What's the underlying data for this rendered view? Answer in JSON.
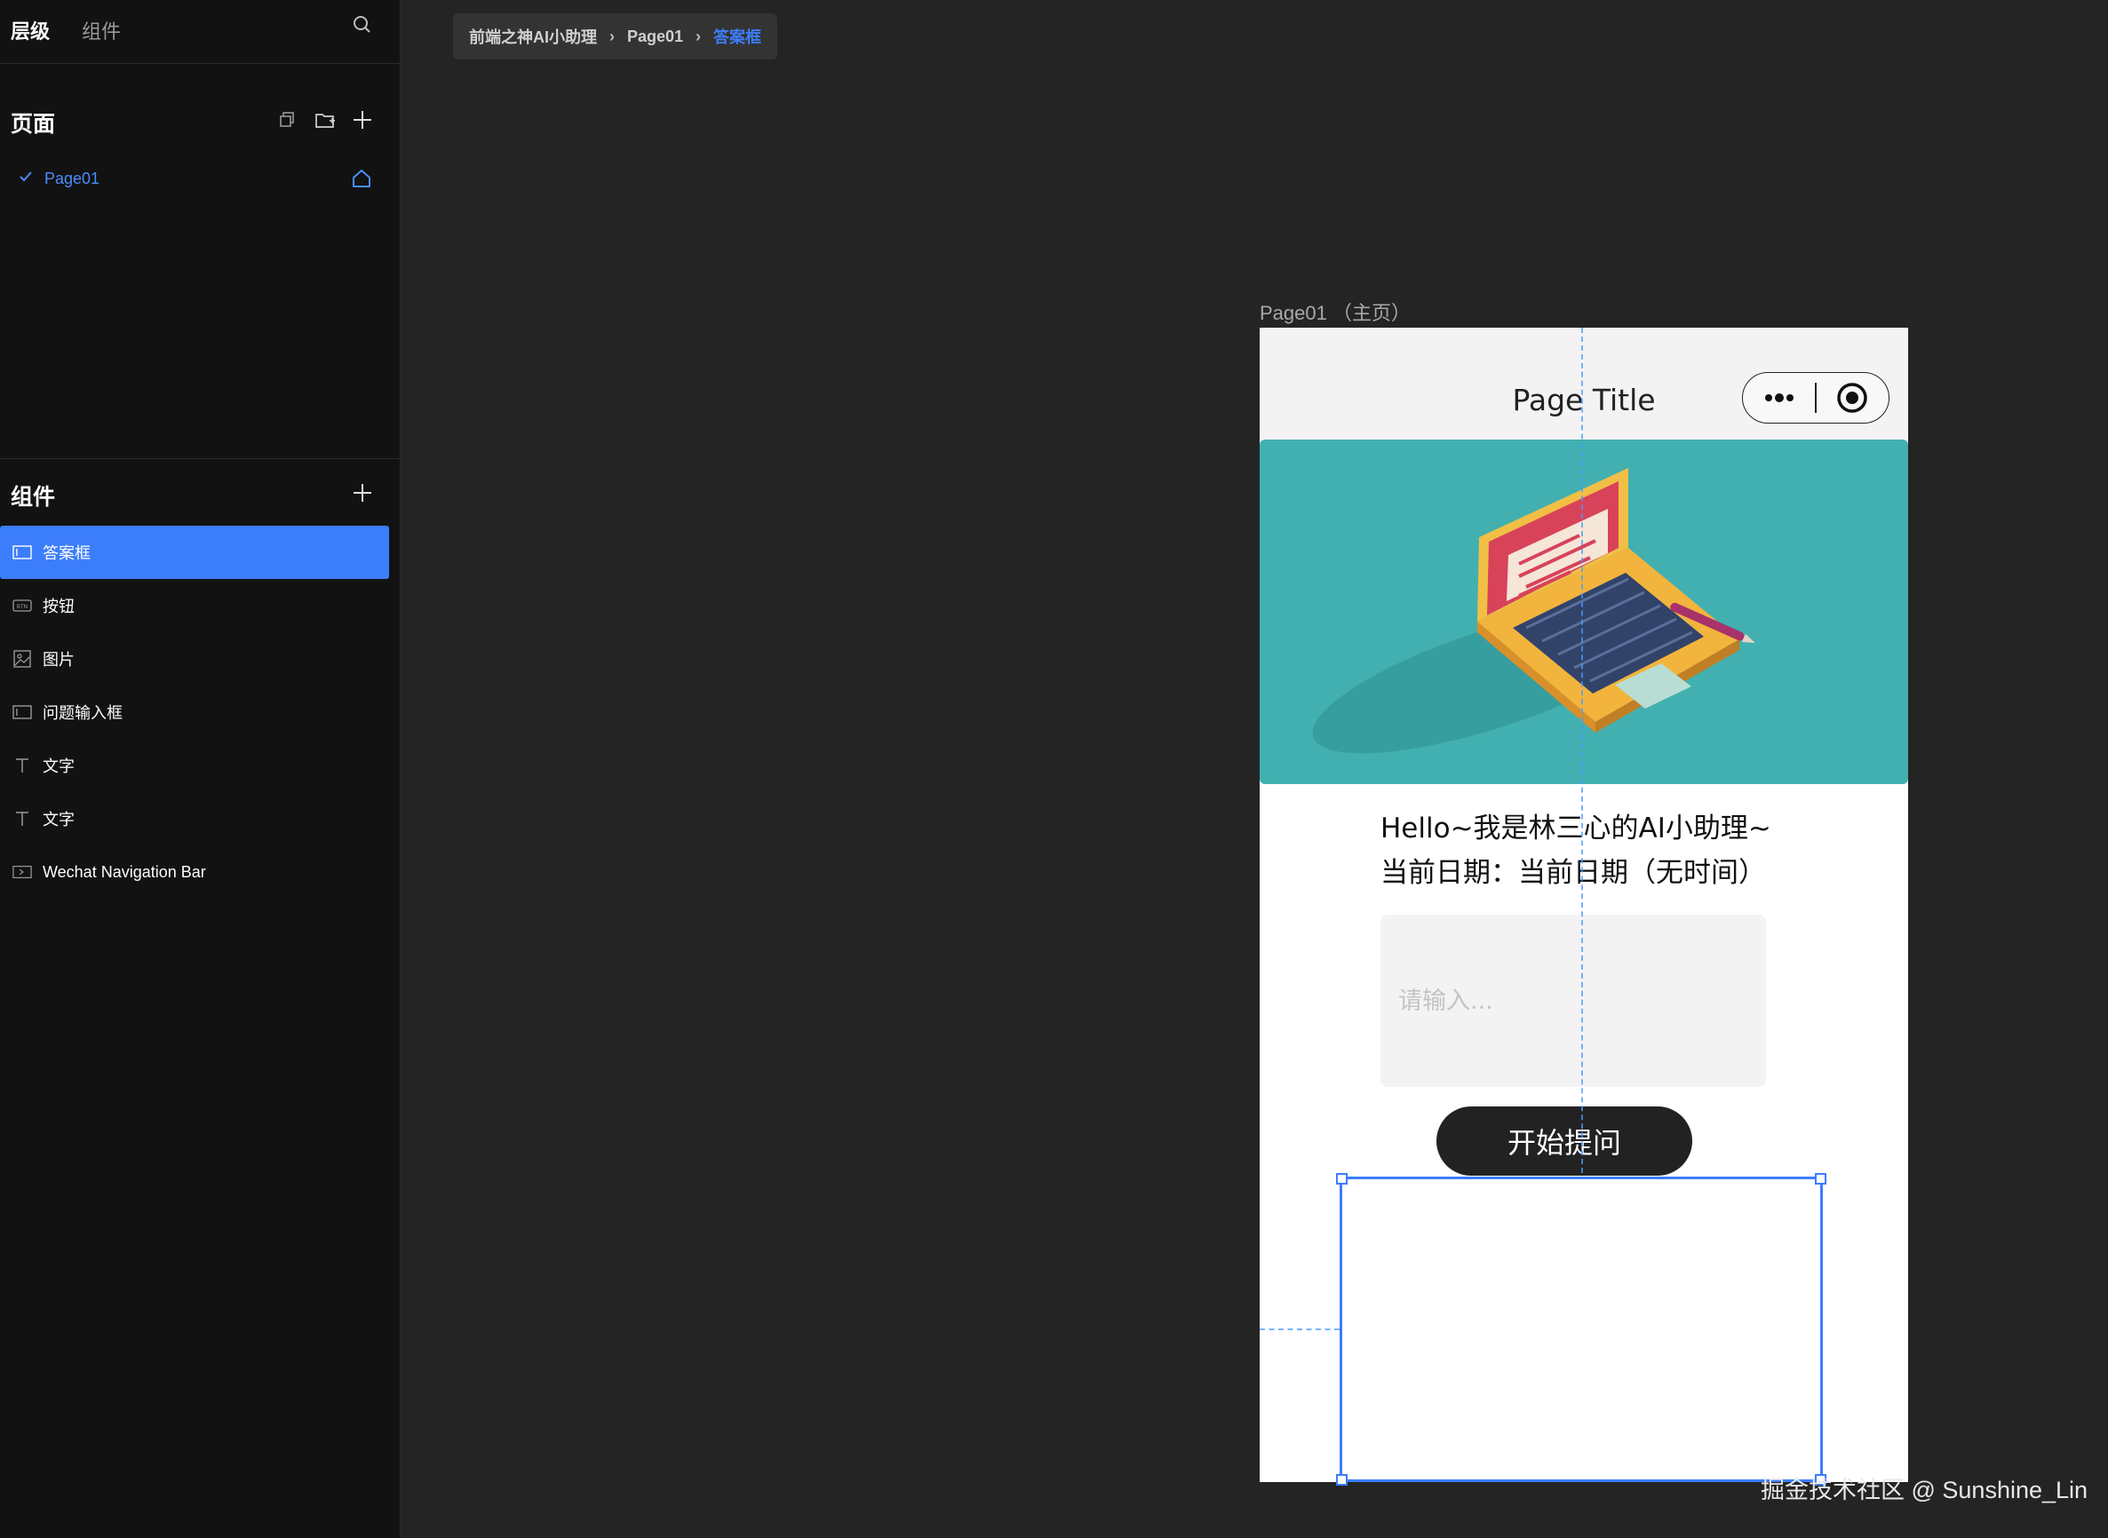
{
  "sidebar": {
    "tabs": [
      {
        "label": "层级",
        "active": true
      },
      {
        "label": "组件",
        "active": false
      }
    ],
    "pages_section": {
      "title": "页面",
      "pages": [
        {
          "label": "Page01",
          "selected": true,
          "is_home": true
        }
      ]
    },
    "components_section": {
      "title": "组件",
      "items": [
        {
          "label": "答案框",
          "icon": "textarea-icon",
          "selected": true
        },
        {
          "label": "按钮",
          "icon": "button-icon",
          "selected": false
        },
        {
          "label": "图片",
          "icon": "image-icon",
          "selected": false
        },
        {
          "label": "问题输入框",
          "icon": "textarea-icon",
          "selected": false
        },
        {
          "label": "文字",
          "icon": "text-icon",
          "selected": false
        },
        {
          "label": "文字",
          "icon": "text-icon",
          "selected": false
        },
        {
          "label": "Wechat Navigation Bar",
          "icon": "navbar-icon",
          "selected": false
        }
      ]
    }
  },
  "breadcrumb": {
    "items": [
      "前端之神AI小助理",
      "Page01",
      "答案框"
    ]
  },
  "canvas": {
    "page_caption": "Page01 （主页）",
    "phone": {
      "nav_title": "Page Title",
      "greeting_line1": "Hello~我是林三心的AI小助理~",
      "greeting_line2": "当前日期：当前日期（无时间）",
      "input_placeholder": "请输入...",
      "ask_button_label": "开始提问"
    }
  },
  "watermark": "掘金技术社区 @ Sunshine_Lin",
  "colors": {
    "accent": "#3c7dfb",
    "banner_bg": "#42b0b0",
    "editor_bg": "#242424",
    "sidebar_bg": "#121212"
  }
}
